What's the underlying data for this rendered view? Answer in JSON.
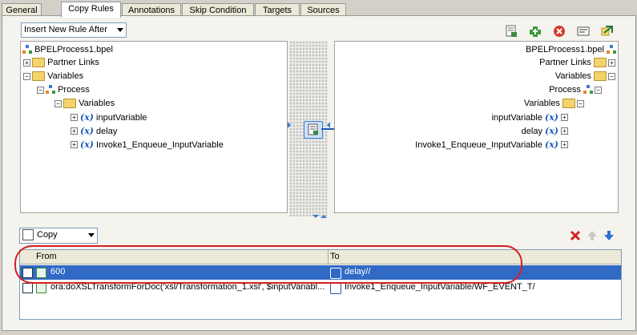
{
  "tabs": [
    "General",
    "Copy Rules",
    "Annotations",
    "Skip Condition",
    "Targets",
    "Sources"
  ],
  "active_tab": "Copy Rules",
  "rule_insert": {
    "selected": "Insert New Rule After"
  },
  "toolbar_icons": [
    "expression-builder-icon",
    "add-rule-icon",
    "delete-icon",
    "xpath-icon",
    "map-icon"
  ],
  "source_tree": [
    {
      "label": "BPELProcess1.bpel",
      "icon": "process-icon"
    },
    {
      "label": "Partner Links",
      "icon": "folder-icon"
    },
    {
      "label": "Variables",
      "icon": "folder-icon"
    },
    {
      "label": "Process",
      "icon": "process-icon"
    },
    {
      "label": "Variables",
      "icon": "folder-icon"
    },
    {
      "label": "inputVariable",
      "icon": "variable-icon"
    },
    {
      "label": "delay",
      "icon": "variable-icon"
    },
    {
      "label": "Invoke1_Enqueue_InputVariable",
      "icon": "variable-icon"
    }
  ],
  "target_tree": [
    {
      "label": "BPELProcess1.bpel",
      "icon": "process-icon"
    },
    {
      "label": "Partner Links",
      "icon": "folder-icon"
    },
    {
      "label": "Variables",
      "icon": "folder-icon"
    },
    {
      "label": "Process",
      "icon": "process-icon"
    },
    {
      "label": "Variables",
      "icon": "folder-icon"
    },
    {
      "label": "inputVariable",
      "icon": "variable-icon"
    },
    {
      "label": "delay",
      "icon": "variable-icon"
    },
    {
      "label": "Invoke1_Enqueue_InputVariable",
      "icon": "variable-icon"
    }
  ],
  "variable_glyph": "(x)",
  "rule_type": {
    "selected": "Copy"
  },
  "grid": {
    "headers": {
      "from": "From",
      "to": "To"
    },
    "rows": [
      {
        "from": "600",
        "to": "delay//",
        "selected": true
      },
      {
        "from": "ora:doXSLTransformForDoc('xsl/Transformation_1.xsl', $inputVariabl...",
        "to": "Invoke1_Enqueue_InputVariable/WF_EVENT_T/",
        "selected": false
      }
    ]
  },
  "colors": {
    "selection": "#316ac5",
    "highlight_ring": "#d42020",
    "link_line": "#1e5bb8"
  }
}
